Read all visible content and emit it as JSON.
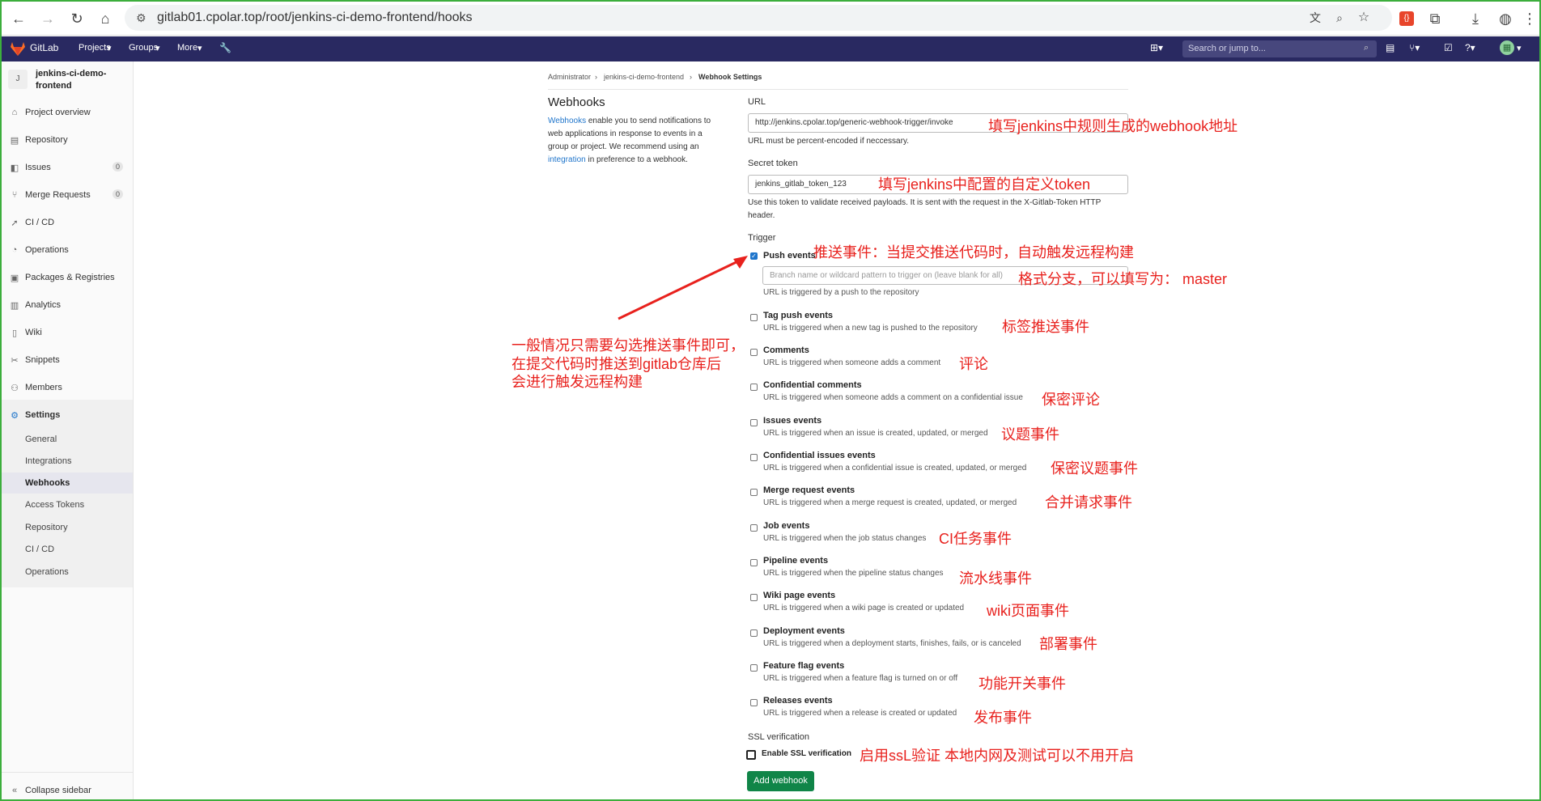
{
  "browser": {
    "url": "gitlab01.cpolar.top/root/jenkins-ci-demo-frontend/hooks"
  },
  "header": {
    "brand": "GitLab",
    "nav": [
      "Projects",
      "Groups",
      "More"
    ],
    "search_placeholder": "Search or jump to..."
  },
  "sidebar": {
    "avatar_letter": "J",
    "project_name_line1": "jenkins-ci-demo-",
    "project_name_line2": "frontend",
    "items": [
      {
        "label": "Project overview"
      },
      {
        "label": "Repository"
      },
      {
        "label": "Issues",
        "count": "0"
      },
      {
        "label": "Merge Requests",
        "count": "0"
      },
      {
        "label": "CI / CD"
      },
      {
        "label": "Operations"
      },
      {
        "label": "Packages & Registries"
      },
      {
        "label": "Analytics"
      },
      {
        "label": "Wiki"
      },
      {
        "label": "Snippets"
      },
      {
        "label": "Members"
      },
      {
        "label": "Settings"
      }
    ],
    "sub_items": [
      "General",
      "Integrations",
      "Webhooks",
      "Access Tokens",
      "Repository",
      "CI / CD",
      "Operations"
    ],
    "collapse": "Collapse sidebar"
  },
  "breadcrumb": [
    "Administrator",
    "jenkins-ci-demo-frontend",
    "Webhook Settings"
  ],
  "intro": {
    "title": "Webhooks",
    "line1_link": "Webhooks",
    "line1_rest": " enable you to send notifications to",
    "line2": "web applications in response to events in a",
    "line3": "group or project. We recommend using an",
    "line4_link": "integration",
    "line4_rest": " in preference to a webhook."
  },
  "form": {
    "url_label": "URL",
    "url_value": "http://jenkins.cpolar.top/generic-webhook-trigger/invoke",
    "url_help": "URL must be percent-encoded if neccessary.",
    "token_label": "Secret token",
    "token_value": "jenkins_gitlab_token_123",
    "token_help1": "Use this token to validate received payloads. It is sent with the request in the X-Gitlab-Token HTTP",
    "token_help2": "header.",
    "trigger_label": "Trigger",
    "branch_placeholder": "Branch name or wildcard pattern to trigger on (leave blank for all)",
    "events": [
      {
        "name": "Push events",
        "desc": "URL is triggered by a push to the repository",
        "checked": true
      },
      {
        "name": "Tag push events",
        "desc": "URL is triggered when a new tag is pushed to the repository"
      },
      {
        "name": "Comments",
        "desc": "URL is triggered when someone adds a comment"
      },
      {
        "name": "Confidential comments",
        "desc": "URL is triggered when someone adds a comment on a confidential issue"
      },
      {
        "name": "Issues events",
        "desc": "URL is triggered when an issue is created, updated, or merged"
      },
      {
        "name": "Confidential issues events",
        "desc": "URL is triggered when a confidential issue is created, updated, or merged"
      },
      {
        "name": "Merge request events",
        "desc": "URL is triggered when a merge request is created, updated, or merged"
      },
      {
        "name": "Job events",
        "desc": "URL is triggered when the job status changes"
      },
      {
        "name": "Pipeline events",
        "desc": "URL is triggered when the pipeline status changes"
      },
      {
        "name": "Wiki page events",
        "desc": "URL is triggered when a wiki page is created or updated"
      },
      {
        "name": "Deployment events",
        "desc": "URL is triggered when a deployment starts, finishes, fails, or is canceled"
      },
      {
        "name": "Feature flag events",
        "desc": "URL is triggered when a feature flag is turned on or off"
      },
      {
        "name": "Releases events",
        "desc": "URL is triggered when a release is created or updated"
      }
    ],
    "ssl_label": "SSL verification",
    "ssl_checkbox": "Enable SSL verification",
    "submit": "Add webhook"
  },
  "annotations": {
    "url_note": "填写jenkins中规则生成的webhook地址",
    "token_note": "填写jenkins中配置的自定义token",
    "push_note": "推送事件：当提交推送代码时，自动触发远程构建",
    "branch_note": "格式分支，可以填写为： master",
    "left_note_1": "一般情况只需要勾选推送事件即可，",
    "left_note_2": "在提交代码时推送到gitlab仓库后",
    "left_note_3": "会进行触发远程构建",
    "event_notes": [
      "标签推送事件",
      "评论",
      "保密评论",
      "议题事件",
      "保密议题事件",
      "合并请求事件",
      "CI任务事件",
      "流水线事件",
      "wiki页面事件",
      "部署事件",
      "功能开关事件",
      "发布事件"
    ],
    "ssl_note": "启用ssL验证  本地内网及测试可以不用开启"
  },
  "colors": {
    "header": "#292961",
    "accent": "#1f75cb",
    "annotation": "#e8211d",
    "button": "#108548"
  }
}
